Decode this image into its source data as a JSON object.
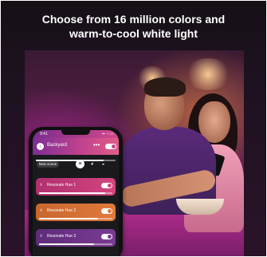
{
  "headline": {
    "line1": "Choose from 16 million colors and",
    "line2": "warm-to-cool white light"
  },
  "colors": {
    "header_gradient": [
      "#7c2e94",
      "#e05e87"
    ],
    "light1": "#d2457f",
    "light2": "#e07a3c",
    "light3": "#7a3b93"
  },
  "phone": {
    "status": {
      "time": "9:41",
      "icons": "▪▪ ◔ ▭"
    },
    "header": {
      "back_icon": "chevron-left-icon",
      "room": "Backyard",
      "more": "•••",
      "toggle_on": true,
      "brightness": 0.85
    },
    "scene_bar": {
      "new_scene": "New scene",
      "icons": [
        "list-icon",
        "palette-icon",
        "color-picker-icon"
      ]
    },
    "lights": [
      {
        "name": "Resonate Hue 1",
        "icon": "bulb-icon",
        "on": true,
        "brightness": 0.9,
        "color": "#d2457f"
      },
      {
        "name": "Resonate Hue 2",
        "icon": "bulb-icon",
        "on": true,
        "brightness": 0.8,
        "color": "#e07a3c"
      },
      {
        "name": "Resonate Hue 3",
        "icon": "bulb-icon",
        "on": true,
        "brightness": 0.75,
        "color": "#7a3b93"
      }
    ]
  }
}
